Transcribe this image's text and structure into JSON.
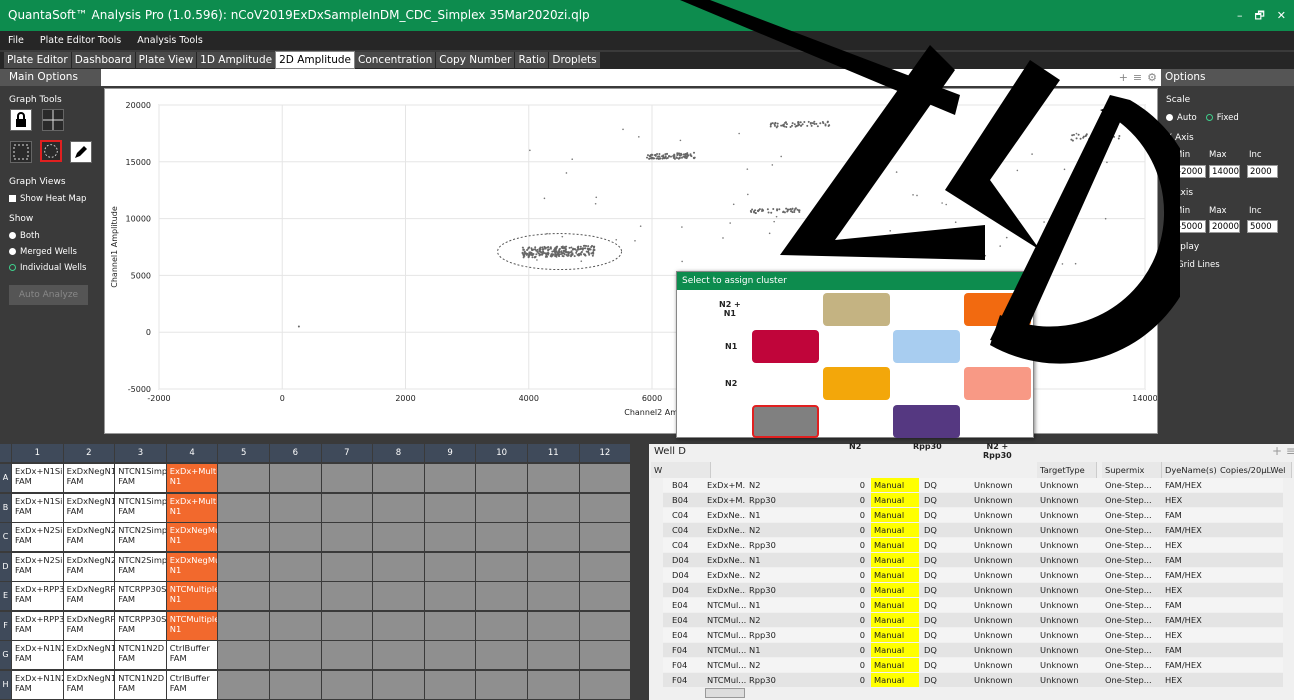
{
  "window": {
    "title": "QuantaSoft™ Analysis Pro (1.0.596): nCoV2019ExDxSampleInDM_CDC_Simplex 35Mar2020zi.qlp",
    "controls": [
      "–",
      "🗗",
      "✕"
    ]
  },
  "menu": [
    "File",
    "Plate Editor Tools",
    "Analysis Tools"
  ],
  "tabs": [
    "Plate Editor",
    "Dashboard",
    "Plate View",
    "1D Amplitude",
    "2D Amplitude",
    "Concentration",
    "Copy Number",
    "Ratio",
    "Droplets"
  ],
  "active_tab": "2D Amplitude",
  "left": {
    "header": "Main Options",
    "graph_tools": "Graph Tools",
    "graph_views": "Graph Views",
    "heat_map": "Show Heat Map",
    "show": "Show",
    "show_options": [
      "Both",
      "Merged Wells",
      "Individual Wells"
    ],
    "auto_analyze": "Auto Analyze"
  },
  "graph": {
    "ylabel": "Channel1 Amplitude",
    "xlabel": "Channel2 Amplitude",
    "yticks": [
      "20000",
      "15000",
      "10000",
      "5000",
      "0",
      "-5000"
    ],
    "xticks": [
      "-2000",
      "0",
      "2000",
      "4000",
      "6000",
      "14000"
    ],
    "toolbar": [
      "+",
      "≡",
      "⚙"
    ]
  },
  "chart_data": {
    "type": "scatter",
    "xlim": [
      -2000,
      14000
    ],
    "ylim": [
      -5000,
      20000
    ],
    "xlabel": "Channel2 Amplitude",
    "ylabel": "Channel1 Amplitude"
  },
  "right": {
    "header": "Options",
    "scale": "Scale",
    "auto": "Auto",
    "fixed": "Fixed",
    "x_axis": "X Axis",
    "y_axis": "Y Axis",
    "min": "Min",
    "max": "Max",
    "inc": "Inc",
    "x_vals": [
      "-2000",
      "14000",
      "2000"
    ],
    "y_vals": [
      "-5000",
      "20000",
      "5000"
    ],
    "display": "Display",
    "grid_lines": "Grid Lines"
  },
  "popup": {
    "title": "Select to assign cluster",
    "row_labels": [
      "N2 +\nN1",
      "N1",
      "N2"
    ],
    "col_labels": [
      "N2",
      "Rpp30",
      "N2 +\nRpp30"
    ],
    "colors": [
      "#c4b382",
      "#f26a10",
      "#c0053a",
      "#a8cdf0",
      "#f3a70a",
      "#f89985",
      "#808080",
      "#553881"
    ]
  },
  "plate": {
    "cols": [
      "1",
      "2",
      "3",
      "4",
      "5",
      "6",
      "7",
      "8",
      "9",
      "10",
      "11",
      "12"
    ],
    "rows": [
      "A",
      "B",
      "C",
      "D",
      "E",
      "F",
      "G",
      "H"
    ],
    "cells": [
      [
        "ExDx+N1Sin",
        "ExDxNegN1",
        "NTCN1Simp",
        "ExDx+Multi"
      ],
      [
        "ExDx+N1Sin",
        "ExDxNegN1",
        "NTCN1Simp",
        "ExDx+Multi"
      ],
      [
        "ExDx+N2Sin",
        "ExDxNegN2",
        "NTCN2Simp",
        "ExDxNegMu"
      ],
      [
        "ExDx+N2Sin",
        "ExDxNegN2",
        "NTCN2Simp",
        "ExDxNegMu"
      ],
      [
        "ExDx+RPP3(",
        "ExDxNegRP",
        "NTCRPP30S",
        "NTCMultiple"
      ],
      [
        "ExDx+RPP3(",
        "ExDxNegRP",
        "NTCRPP30S",
        "NTCMultiple"
      ],
      [
        "ExDx+N1N2",
        "ExDxNegN1",
        "NTCN1N2D",
        "CtrlBuffer"
      ],
      [
        "ExDx+N1N2",
        "ExDxNegN1",
        "NTCN1N2D",
        "CtrlBuffer"
      ]
    ],
    "sub": [
      [
        "FAM",
        "FAM",
        "FAM",
        "N1"
      ],
      [
        "FAM",
        "FAM",
        "FAM",
        "N1"
      ],
      [
        "FAM",
        "FAM",
        "FAM",
        "N1"
      ],
      [
        "FAM",
        "FAM",
        "FAM",
        "N1"
      ],
      [
        "FAM",
        "FAM",
        "FAM",
        "N1"
      ],
      [
        "FAM",
        "FAM",
        "FAM",
        "N1"
      ],
      [
        "FAM",
        "FAM",
        "FAM",
        "FAM"
      ],
      [
        "FAM",
        "FAM",
        "FAM",
        "FAM"
      ]
    ]
  },
  "table": {
    "title": "Well D",
    "headers": [
      "W",
      "TargetType",
      "Supermix",
      "DyeName(s)",
      "Copies/20µLWel"
    ],
    "rows": [
      [
        "B04",
        "ExDx+M...",
        "N2",
        "0",
        "Manual",
        "DQ",
        "Unknown",
        "Unknown",
        "One-Step...",
        "FAM/HEX"
      ],
      [
        "B04",
        "ExDx+M...",
        "Rpp30",
        "0",
        "Manual",
        "DQ",
        "Unknown",
        "Unknown",
        "One-Step...",
        "HEX"
      ],
      [
        "C04",
        "ExDxNe...",
        "N1",
        "0",
        "Manual",
        "DQ",
        "Unknown",
        "Unknown",
        "One-Step...",
        "FAM"
      ],
      [
        "C04",
        "ExDxNe...",
        "N2",
        "0",
        "Manual",
        "DQ",
        "Unknown",
        "Unknown",
        "One-Step...",
        "FAM/HEX"
      ],
      [
        "C04",
        "ExDxNe...",
        "Rpp30",
        "0",
        "Manual",
        "DQ",
        "Unknown",
        "Unknown",
        "One-Step...",
        "HEX"
      ],
      [
        "D04",
        "ExDxNe...",
        "N1",
        "0",
        "Manual",
        "DQ",
        "Unknown",
        "Unknown",
        "One-Step...",
        "FAM"
      ],
      [
        "D04",
        "ExDxNe...",
        "N2",
        "0",
        "Manual",
        "DQ",
        "Unknown",
        "Unknown",
        "One-Step...",
        "FAM/HEX"
      ],
      [
        "D04",
        "ExDxNe...",
        "Rpp30",
        "0",
        "Manual",
        "DQ",
        "Unknown",
        "Unknown",
        "One-Step...",
        "HEX"
      ],
      [
        "E04",
        "NTCMul...",
        "N1",
        "0",
        "Manual",
        "DQ",
        "Unknown",
        "Unknown",
        "One-Step...",
        "FAM"
      ],
      [
        "E04",
        "NTCMul...",
        "N2",
        "0",
        "Manual",
        "DQ",
        "Unknown",
        "Unknown",
        "One-Step...",
        "FAM/HEX"
      ],
      [
        "E04",
        "NTCMul...",
        "Rpp30",
        "0",
        "Manual",
        "DQ",
        "Unknown",
        "Unknown",
        "One-Step...",
        "HEX"
      ],
      [
        "F04",
        "NTCMul...",
        "N1",
        "0",
        "Manual",
        "DQ",
        "Unknown",
        "Unknown",
        "One-Step...",
        "FAM"
      ],
      [
        "F04",
        "NTCMul...",
        "N2",
        "0",
        "Manual",
        "DQ",
        "Unknown",
        "Unknown",
        "One-Step...",
        "FAM/HEX"
      ],
      [
        "F04",
        "NTCMul...",
        "Rpp30",
        "0",
        "Manual",
        "DQ",
        "Unknown",
        "Unknown",
        "One-Step...",
        "HEX"
      ]
    ]
  }
}
